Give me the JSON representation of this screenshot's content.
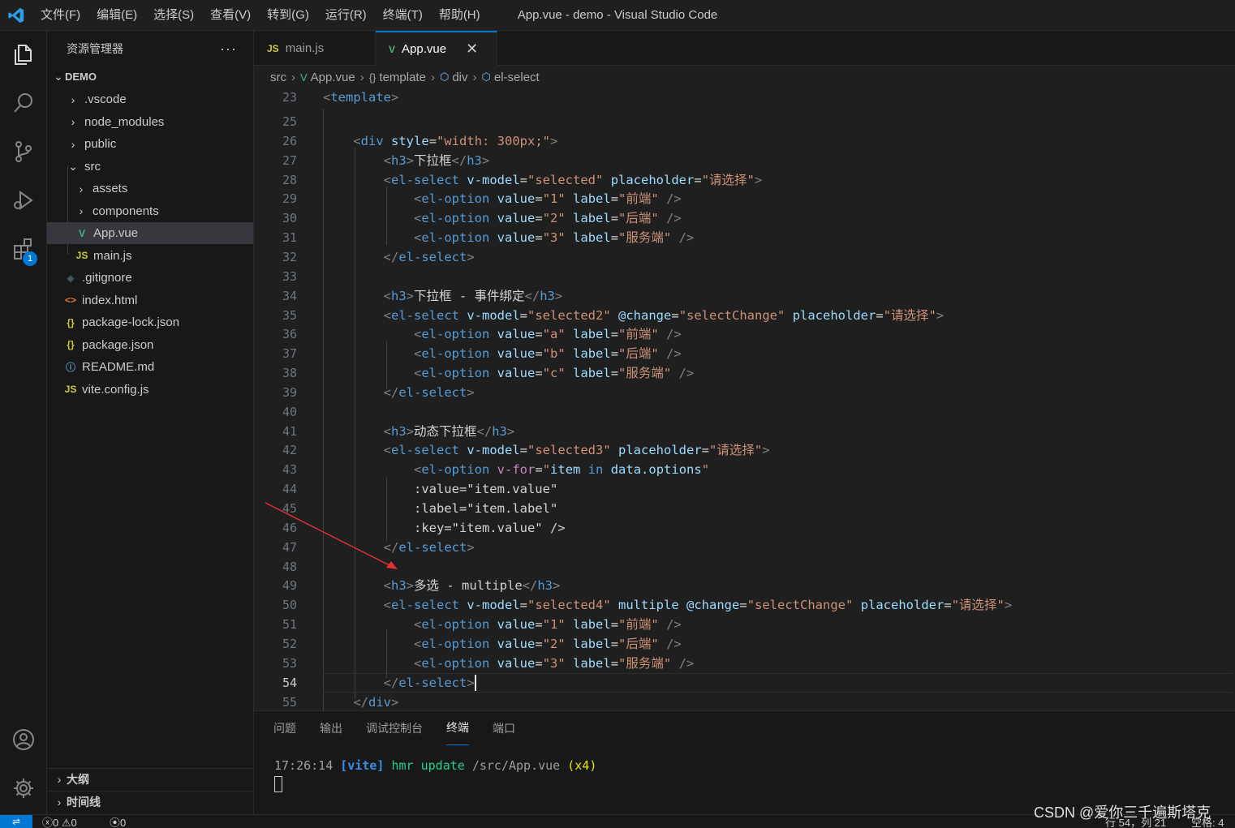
{
  "window": {
    "title": "App.vue - demo - Visual Studio Code"
  },
  "menu": [
    "文件(F)",
    "编辑(E)",
    "选择(S)",
    "查看(V)",
    "转到(G)",
    "运行(R)",
    "终端(T)",
    "帮助(H)"
  ],
  "explorer": {
    "title": "资源管理器",
    "more": "···",
    "root": "DEMO",
    "items": [
      {
        "label": ".vscode",
        "type": "folder",
        "icon": "chevron-right"
      },
      {
        "label": "node_modules",
        "type": "folder",
        "icon": "chevron-right"
      },
      {
        "label": "public",
        "type": "folder",
        "icon": "chevron-right"
      },
      {
        "label": "src",
        "type": "folder-open",
        "icon": "chevron-down"
      },
      {
        "label": "assets",
        "type": "folder",
        "icon": "chevron-right"
      },
      {
        "label": "components",
        "type": "folder",
        "icon": "chevron-right"
      },
      {
        "label": "App.vue",
        "type": "vue",
        "icon": "vue-icon"
      },
      {
        "label": "main.js",
        "type": "js",
        "icon": "js-icon"
      },
      {
        "label": ".gitignore",
        "type": "git",
        "icon": "git-icon"
      },
      {
        "label": "index.html",
        "type": "html",
        "icon": "html-icon"
      },
      {
        "label": "package-lock.json",
        "type": "json",
        "icon": "json-icon"
      },
      {
        "label": "package.json",
        "type": "json",
        "icon": "json-icon"
      },
      {
        "label": "README.md",
        "type": "info",
        "icon": "info-icon"
      },
      {
        "label": "vite.config.js",
        "type": "js",
        "icon": "js-icon"
      }
    ],
    "outline": "大纲",
    "timeline": "时间线"
  },
  "activity": {
    "extensions_badge": "1"
  },
  "tabs": [
    {
      "label": "main.js",
      "icon": "JS",
      "active": false
    },
    {
      "label": "App.vue",
      "icon": "V",
      "active": true,
      "close": "✕"
    }
  ],
  "breadcrumb": [
    "src",
    "App.vue",
    "template",
    "div",
    "el-select"
  ],
  "editor": {
    "current_line": "54",
    "lines": [
      {
        "n": "23",
        "code": "<template>"
      },
      {
        "n": "25",
        "code": ""
      },
      {
        "n": "26",
        "code": "    <div style=\"width: 300px;\">"
      },
      {
        "n": "27",
        "code": "        <h3>下拉框</h3>"
      },
      {
        "n": "28",
        "code": "        <el-select v-model=\"selected\" placeholder=\"请选择\">"
      },
      {
        "n": "29",
        "code": "            <el-option value=\"1\" label=\"前端\" />"
      },
      {
        "n": "30",
        "code": "            <el-option value=\"2\" label=\"后端\" />"
      },
      {
        "n": "31",
        "code": "            <el-option value=\"3\" label=\"服务端\" />"
      },
      {
        "n": "32",
        "code": "        </el-select>"
      },
      {
        "n": "33",
        "code": ""
      },
      {
        "n": "34",
        "code": "        <h3>下拉框 - 事件绑定</h3>"
      },
      {
        "n": "35",
        "code": "        <el-select v-model=\"selected2\" @change=\"selectChange\" placeholder=\"请选择\">"
      },
      {
        "n": "36",
        "code": "            <el-option value=\"a\" label=\"前端\" />"
      },
      {
        "n": "37",
        "code": "            <el-option value=\"b\" label=\"后端\" />"
      },
      {
        "n": "38",
        "code": "            <el-option value=\"c\" label=\"服务端\" />"
      },
      {
        "n": "39",
        "code": "        </el-select>"
      },
      {
        "n": "40",
        "code": ""
      },
      {
        "n": "41",
        "code": "        <h3>动态下拉框</h3>"
      },
      {
        "n": "42",
        "code": "        <el-select v-model=\"selected3\" placeholder=\"请选择\">"
      },
      {
        "n": "43",
        "code": "            <el-option v-for=\"item in data.options\""
      },
      {
        "n": "44",
        "code": "            :value=\"item.value\""
      },
      {
        "n": "45",
        "code": "            :label=\"item.label\""
      },
      {
        "n": "46",
        "code": "            :key=\"item.value\" />"
      },
      {
        "n": "47",
        "code": "        </el-select>"
      },
      {
        "n": "48",
        "code": ""
      },
      {
        "n": "49",
        "code": "        <h3>多选 - multiple</h3>"
      },
      {
        "n": "50",
        "code": "        <el-select v-model=\"selected4\" multiple @change=\"selectChange\" placeholder=\"请选择\">"
      },
      {
        "n": "51",
        "code": "            <el-option value=\"1\" label=\"前端\" />"
      },
      {
        "n": "52",
        "code": "            <el-option value=\"2\" label=\"后端\" />"
      },
      {
        "n": "53",
        "code": "            <el-option value=\"3\" label=\"服务端\" />"
      },
      {
        "n": "54",
        "code": "        </el-select>"
      },
      {
        "n": "55",
        "code": "    </div>"
      }
    ]
  },
  "panel": {
    "tabs": [
      "问题",
      "输出",
      "调试控制台",
      "终端",
      "端口"
    ],
    "active_tab": "终端",
    "terminal": {
      "time": "17:26:14",
      "tag": "[vite]",
      "msg": "hmr update",
      "path": "/src/App.vue",
      "count": "(x4)"
    }
  },
  "statusbar": {
    "errors": "0",
    "warnings": "0",
    "ports": "0",
    "position": "行 54，列 21",
    "spaces": "空格: 4"
  },
  "watermark": "CSDN @爱你三千遍斯塔克",
  "colors": {
    "accent": "#0078d4",
    "annotation_arrow": "#e03030"
  }
}
